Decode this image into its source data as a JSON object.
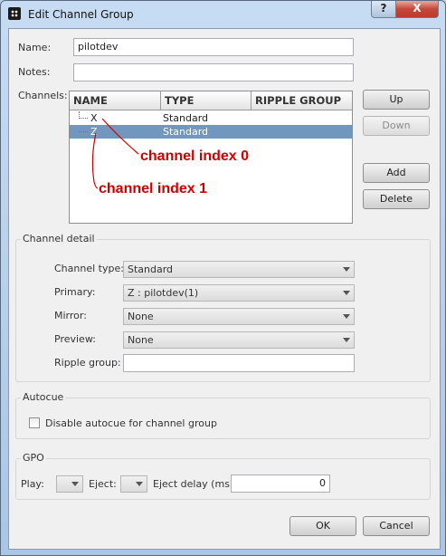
{
  "window": {
    "title": "Edit Channel Group",
    "help_glyph": "?",
    "close_glyph": "X"
  },
  "form": {
    "name_label": "Name:",
    "name_value": "pilotdev",
    "notes_label": "Notes:",
    "notes_value": "",
    "channels_label": "Channels:"
  },
  "channels_table": {
    "columns": [
      "NAME",
      "TYPE",
      "RIPPLE GROUP"
    ],
    "rows": [
      {
        "name": "X",
        "type": "Standard",
        "ripple_group": "",
        "selected": false
      },
      {
        "name": "Z",
        "type": "Standard",
        "ripple_group": "",
        "selected": true
      }
    ]
  },
  "side_buttons": {
    "up": "Up",
    "down": "Down",
    "add": "Add",
    "delete": "Delete"
  },
  "annotations": {
    "index0": "channel index 0",
    "index1": "channel index 1",
    "color": "#d10000"
  },
  "channel_detail": {
    "title": "Channel detail",
    "channel_type_label": "Channel type:",
    "channel_type_value": "Standard",
    "primary_label": "Primary:",
    "primary_value": "Z : pilotdev(1)",
    "mirror_label": "Mirror:",
    "mirror_value": "None",
    "preview_label": "Preview:",
    "preview_value": "None",
    "ripple_group_label": "Ripple group:",
    "ripple_group_value": ""
  },
  "autocue": {
    "title": "Autocue",
    "checkbox_label": "Disable autocue for channel group",
    "checked": false
  },
  "gpo": {
    "title": "GPO",
    "play_label": "Play:",
    "eject_label": "Eject:",
    "eject_delay_label": "Eject delay (ms):",
    "eject_delay_value": "0"
  },
  "footer": {
    "ok": "OK",
    "cancel": "Cancel"
  },
  "icons": {
    "app": "app-icon",
    "help": "help-icon",
    "close": "close-icon",
    "dropdown": "chevron-down-icon",
    "checkbox": "checkbox-icon"
  }
}
